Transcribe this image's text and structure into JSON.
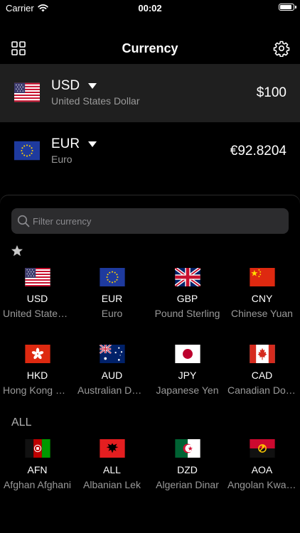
{
  "status_bar": {
    "carrier": "Carrier",
    "time": "00:02",
    "battery_level": 0.95
  },
  "nav": {
    "title": "Currency",
    "left_icon": "grid-icon",
    "right_icon": "gear-icon"
  },
  "converter": [
    {
      "code": "USD",
      "name": "United States Dollar",
      "amount": "$100",
      "flag": "us"
    },
    {
      "code": "EUR",
      "name": "Euro",
      "amount": "€92.8204",
      "flag": "eu"
    }
  ],
  "search": {
    "placeholder": "Filter currency",
    "value": ""
  },
  "favorites_icon": "star-icon",
  "favorites": [
    {
      "code": "USD",
      "name": "United States Dollar",
      "flag": "us"
    },
    {
      "code": "EUR",
      "name": "Euro",
      "flag": "eu"
    },
    {
      "code": "GBP",
      "name": "Pound Sterling",
      "flag": "gb"
    },
    {
      "code": "CNY",
      "name": "Chinese Yuan",
      "flag": "cn"
    },
    {
      "code": "HKD",
      "name": "Hong Kong Dollar",
      "flag": "hk"
    },
    {
      "code": "AUD",
      "name": "Australian Dollar",
      "flag": "au"
    },
    {
      "code": "JPY",
      "name": "Japanese Yen",
      "flag": "jp"
    },
    {
      "code": "CAD",
      "name": "Canadian Dollar",
      "flag": "ca"
    }
  ],
  "all_label": "ALL",
  "all_currencies": [
    {
      "code": "AFN",
      "name": "Afghan Afghani",
      "flag": "af"
    },
    {
      "code": "ALL",
      "name": "Albanian Lek",
      "flag": "al"
    },
    {
      "code": "DZD",
      "name": "Algerian Dinar",
      "flag": "dz"
    },
    {
      "code": "AOA",
      "name": "Angolan Kwanza",
      "flag": "ao"
    }
  ]
}
